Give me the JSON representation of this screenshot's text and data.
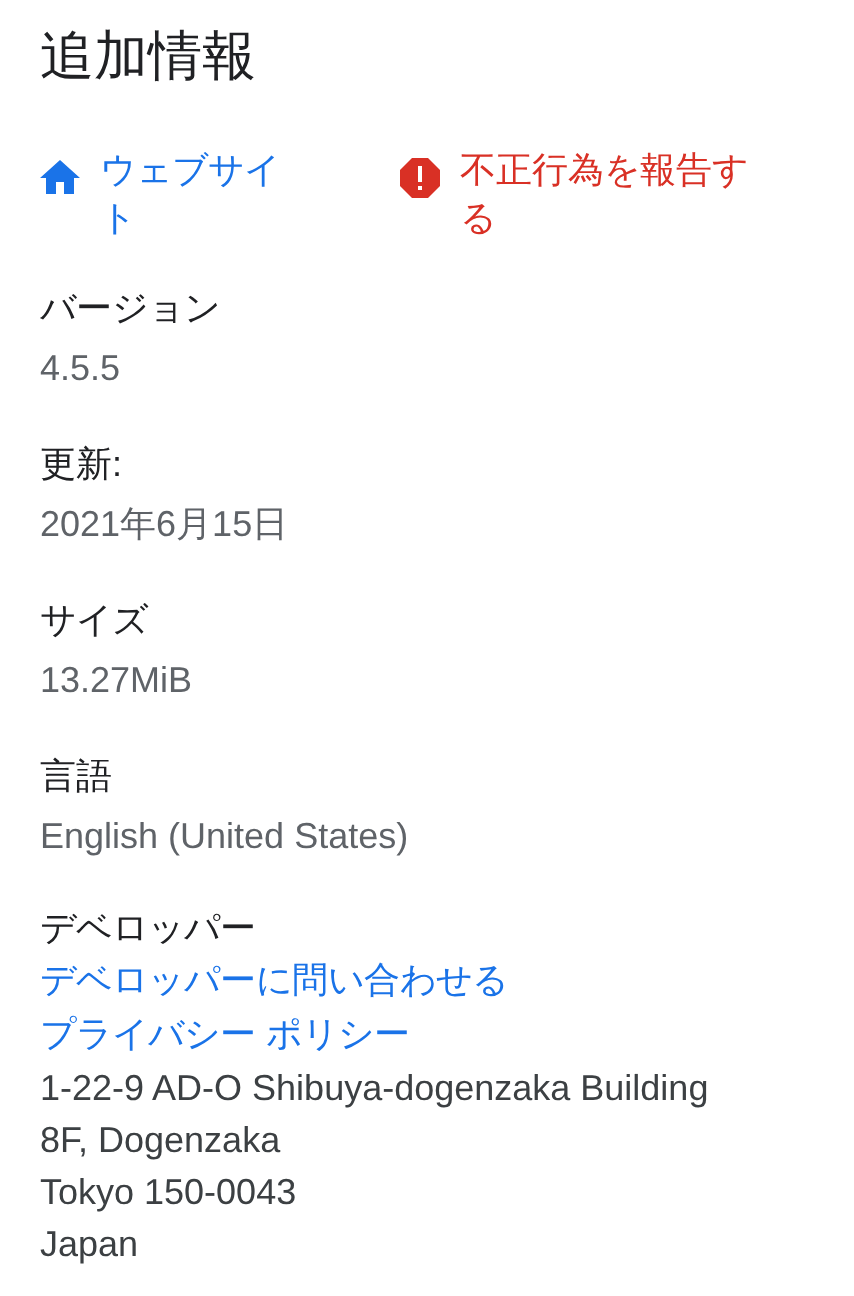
{
  "title": "追加情報",
  "links": [
    {
      "kind": "website",
      "label": "ウェブサイト"
    },
    {
      "kind": "report",
      "label": "不正行為を報告する"
    }
  ],
  "fields": [
    {
      "label": "バージョン",
      "value": "4.5.5"
    },
    {
      "label": "更新:",
      "value": "2021年6月15日"
    },
    {
      "label": "サイズ",
      "value": "13.27MiB"
    },
    {
      "label": "言語",
      "value": "English (United States)"
    }
  ],
  "developer": {
    "label": "デベロッパー",
    "links": [
      "デベロッパーに問い合わせる",
      "プライバシー ポリシー"
    ],
    "address": [
      "1-22-9 AD-O Shibuya-dogenzaka Building",
      "8F, Dogenzaka",
      "Tokyo 150-0043",
      "Japan"
    ]
  }
}
